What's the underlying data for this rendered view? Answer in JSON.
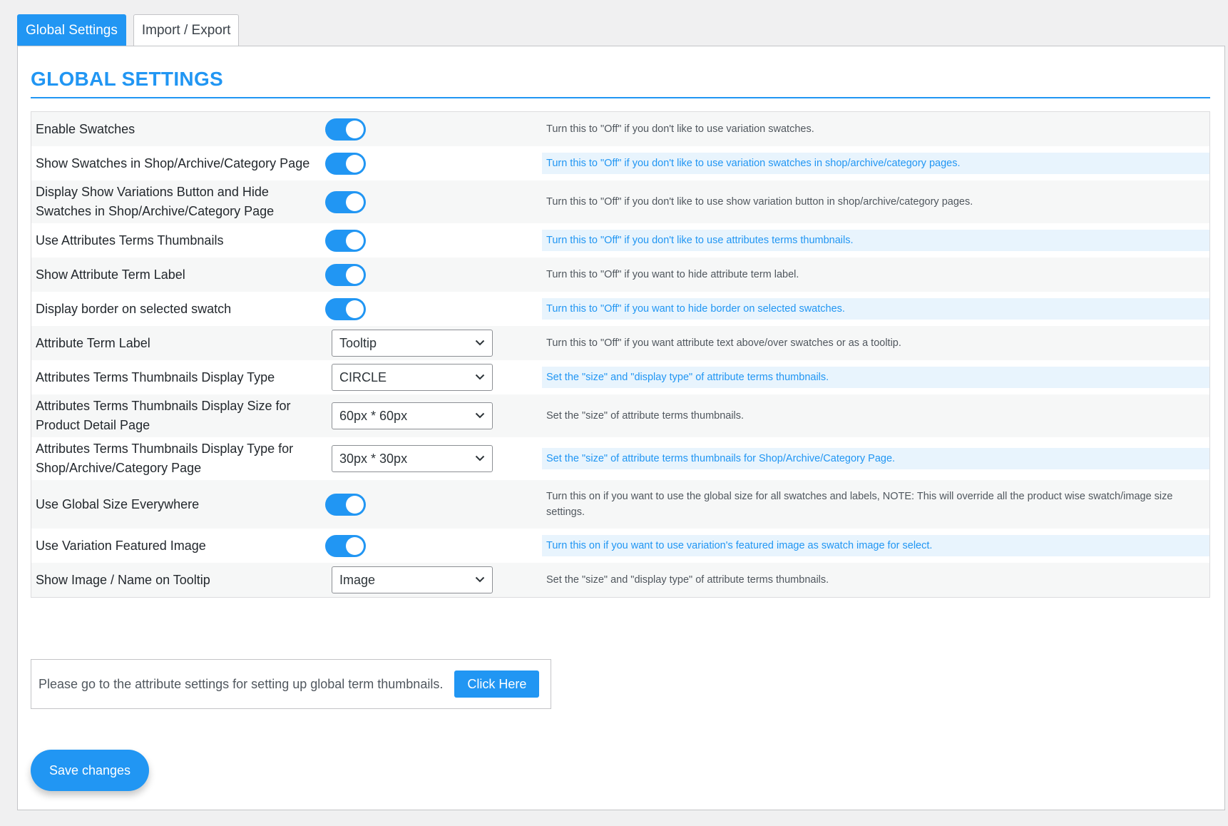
{
  "tabs": [
    {
      "label": "Global Settings",
      "active": true
    },
    {
      "label": "Import / Export",
      "active": false
    }
  ],
  "page_title": "GLOBAL SETTINGS",
  "settings": [
    {
      "label": "Enable Swatches",
      "control": "toggle",
      "on": true,
      "desc": "Turn this to \"Off\" if you don't like to use variation swatches."
    },
    {
      "label": "Show Swatches in Shop/Archive/Category Page",
      "control": "toggle",
      "on": true,
      "desc": "Turn this to \"Off\" if you don't like to use variation swatches in shop/archive/category pages."
    },
    {
      "label": "Display Show Variations Button and Hide Swatches in Shop/Archive/Category Page",
      "control": "toggle",
      "on": true,
      "desc": "Turn this to \"Off\" if you don't like to use show variation button in shop/archive/category pages."
    },
    {
      "label": "Use Attributes Terms Thumbnails",
      "control": "toggle",
      "on": true,
      "desc": "Turn this to \"Off\" if you don't like to use attributes terms thumbnails."
    },
    {
      "label": "Show Attribute Term Label",
      "control": "toggle",
      "on": true,
      "desc": "Turn this to \"Off\" if you want to hide attribute term label."
    },
    {
      "label": "Display border on selected swatch",
      "control": "toggle",
      "on": true,
      "desc": "Turn this to \"Off\" if you want to hide border on selected swatches."
    },
    {
      "label": "Attribute Term Label",
      "control": "select",
      "value": "Tooltip",
      "desc": "Turn this to \"Off\" if you want attribute text above/over swatches or as a tooltip."
    },
    {
      "label": "Attributes Terms Thumbnails Display Type",
      "control": "select",
      "value": "CIRCLE",
      "desc": "Set the \"size\" and \"display type\" of attribute terms thumbnails."
    },
    {
      "label": "Attributes Terms Thumbnails Display Size for Product Detail Page",
      "control": "select",
      "value": "60px * 60px",
      "desc": "Set the \"size\" of attribute terms thumbnails."
    },
    {
      "label": "Attributes Terms Thumbnails Display Type for Shop/Archive/Category Page",
      "control": "select",
      "value": "30px * 30px",
      "desc": "Set the \"size\" of attribute terms thumbnails for Shop/Archive/Category Page."
    },
    {
      "label": "Use Global Size Everywhere",
      "control": "toggle",
      "on": true,
      "desc": "Turn this on if you want to use the global size for all swatches and labels, NOTE: This will override all the product wise swatch/image size settings."
    },
    {
      "label": "Use Variation Featured Image",
      "control": "toggle",
      "on": true,
      "desc": "Turn this on if you want to use variation's featured image as swatch image for select."
    },
    {
      "label": "Show Image / Name on Tooltip",
      "control": "select",
      "value": "Image",
      "desc": "Set the \"size\" and \"display type\" of attribute terms thumbnails."
    }
  ],
  "notice": {
    "text": "Please go to the attribute settings for setting up global term thumbnails.",
    "button_label": "Click Here"
  },
  "save_label": "Save changes",
  "colors": {
    "accent": "#2196f3",
    "highlight_bg": "#e8f4fd"
  }
}
